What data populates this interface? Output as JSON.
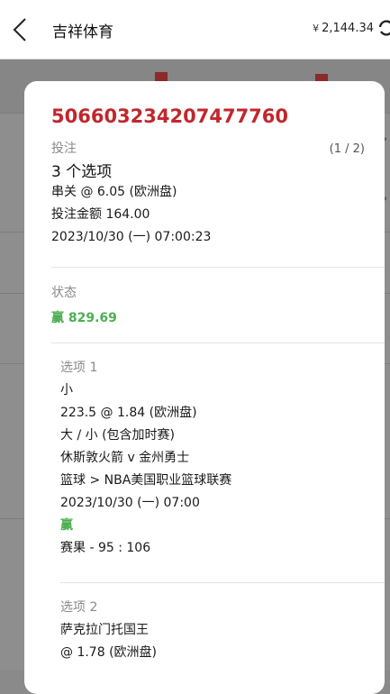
{
  "header": {
    "title": "吉祥体育",
    "currency_symbol": "¥",
    "balance": "2,144.34"
  },
  "modal": {
    "bet_id": "506603234207477760",
    "counter": "(1 / 2)",
    "bet_label": "投注",
    "selections_count": "3 个选项",
    "parlay": "串关 @ 6.05 (欧洲盘)",
    "stake": "投注金额 164.00",
    "placed_time": "2023/10/30 (一) 07:00:23",
    "status_label": "状态",
    "status_value": "赢 829.69",
    "selections": [
      {
        "title": "选项 1",
        "pick": "小",
        "odds": "223.5 @ 1.84 (欧洲盘)",
        "market": "大 / 小 (包含加时赛)",
        "match": "休斯敦火箭 v 金州勇士",
        "league": "篮球 > NBA美国职业篮球联赛",
        "time": "2023/10/30 (一) 07:00",
        "result": "赢",
        "score": "赛果 - 95 : 106"
      },
      {
        "title": "选项 2",
        "pick": "萨克拉门托国王",
        "odds": "@ 1.78 (欧洲盘)"
      }
    ]
  },
  "colors": {
    "accent_red": "#c0272d",
    "win_green": "#4caf50"
  },
  "icons": {
    "back": "chevron-left-icon",
    "refresh": "refresh-icon"
  }
}
